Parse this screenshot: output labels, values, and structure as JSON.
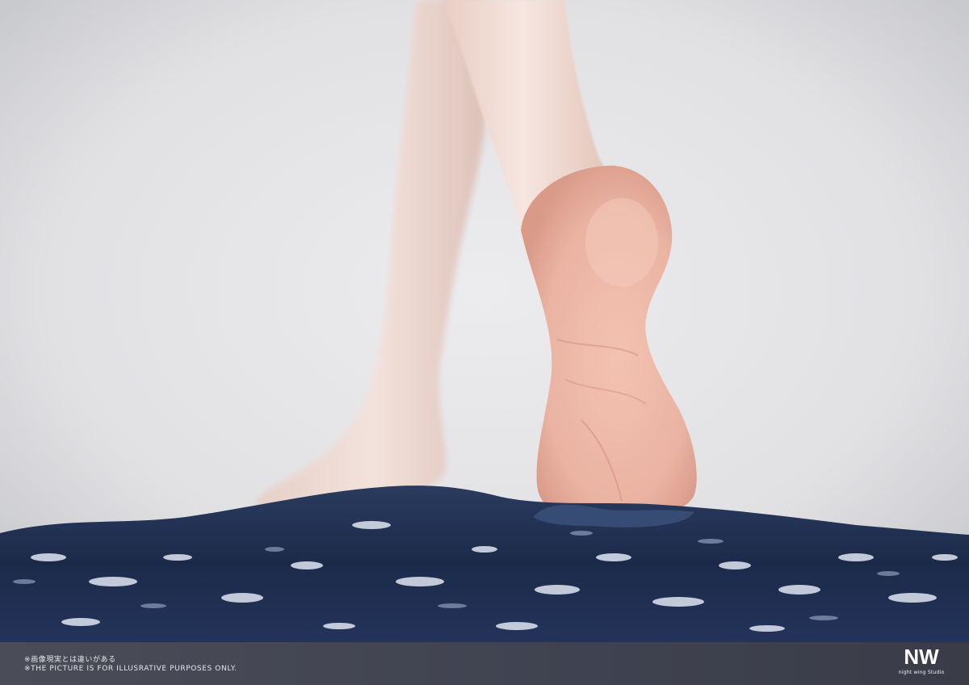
{
  "footer": {
    "disclaimer_jp": "※画像現実とは違いがある",
    "disclaimer_en": "※THE PICTURE IS FOR ILLUSRATIVE PURPOSES ONLY.",
    "logo_mark": "NW",
    "logo_name": "night wing Studio"
  },
  "colors": {
    "background": "#d9d9dc",
    "water": "#1d2c4c",
    "skin": "#f1cfc2",
    "footer_bar": "#43454f"
  }
}
